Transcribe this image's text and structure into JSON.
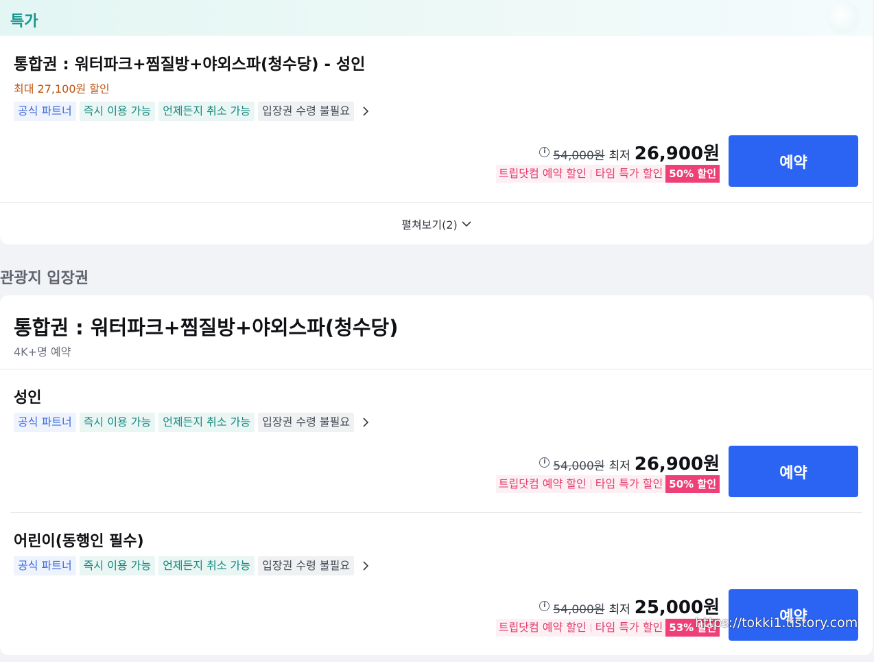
{
  "deal_section": {
    "header_title": "특가",
    "product_title": "통합권 : 워터파크+찜질방+야외스파(청수당) - 성인",
    "max_discount": "최대 27,100원 할인",
    "tags": [
      "공식 파트너",
      "즉시 이용 가능",
      "언제든지 취소 가능",
      "입장권 수령 불필요"
    ],
    "original_price": "54,000원",
    "min_label": "최저",
    "final_price": "26,900원",
    "badges": [
      "트립닷컴 예약 할인",
      "타임 특가 할인"
    ],
    "discount_badge": "50% 할인",
    "book_label": "예약",
    "expand_label": "펼쳐보기(2)"
  },
  "attractions_section": {
    "section_title": "관광지 입장권",
    "product_title": "통합권 : 워터파크+찜질방+야외스파(청수당)",
    "bookings": "4K+명 예약",
    "options": [
      {
        "name": "성인",
        "tags": [
          "공식 파트너",
          "즉시 이용 가능",
          "언제든지 취소 가능",
          "입장권 수령 불필요"
        ],
        "original_price": "54,000원",
        "min_label": "최저",
        "final_price": "26,900원",
        "badges": [
          "트립닷컴 예약 할인",
          "타임 특가 할인"
        ],
        "discount_badge": "50% 할인",
        "book_label": "예약"
      },
      {
        "name": "어린이(동행인 필수)",
        "tags": [
          "공식 파트너",
          "즉시 이용 가능",
          "언제든지 취소 가능",
          "입장권 수령 불필요"
        ],
        "original_price": "54,000원",
        "min_label": "최저",
        "final_price": "25,000원",
        "badges": [
          "트립닷컴 예약 할인",
          "타임 특가 할인"
        ],
        "discount_badge": "53% 할인",
        "book_label": "예약"
      }
    ]
  },
  "watermark": "https://tokki1.tistory.com",
  "colors": {
    "accent_blue": "#2b64f3",
    "deal_teal": "#16958e",
    "discount_orange": "#c0520f",
    "badge_pink": "#ee3f77",
    "badge_pink_text": "#e23c6d"
  },
  "icons": [
    "info-icon",
    "chevron-right-icon",
    "chevron-down-icon"
  ]
}
